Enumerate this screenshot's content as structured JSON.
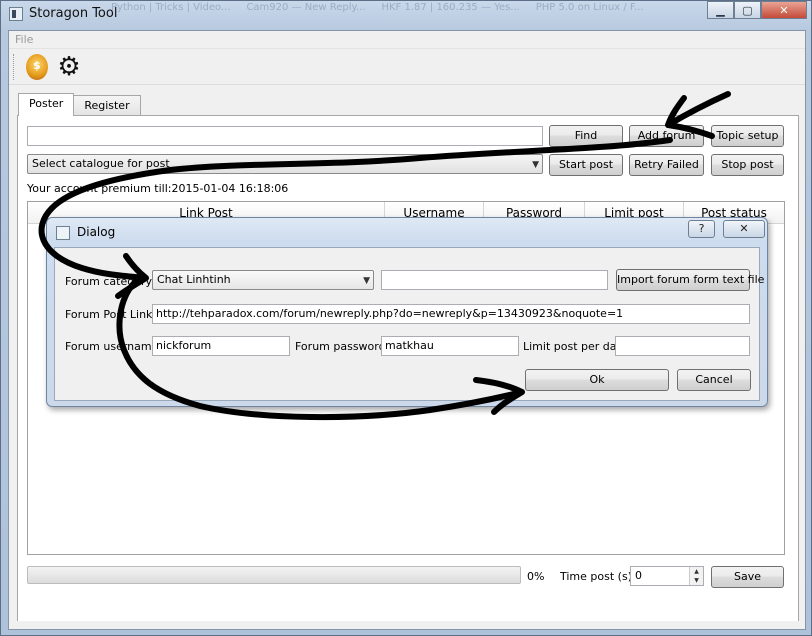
{
  "window": {
    "title": "Storagon Tool",
    "buttons": {
      "minimize": "▁",
      "maximize": "▢",
      "close": "✕"
    }
  },
  "background_tabs": [
    "Python | Tricks | Video...",
    "Cam920 — New Reply...",
    "HKF 1.87 | 160.235 — Yes...",
    "PHP 5.0 on Linux / F..."
  ],
  "menu": {
    "items": [
      "File"
    ]
  },
  "toolbar": {
    "icons": [
      "premium-user-icon",
      "gear-icon"
    ]
  },
  "tabs": [
    {
      "label": "Poster",
      "active": true
    },
    {
      "label": "Register",
      "active": false
    }
  ],
  "poster": {
    "search_value": "",
    "find_label": "Find",
    "add_forum_label": "Add forum",
    "topic_setup_label": "Topic setup",
    "catalogue_placeholder": "Select catalogue for post",
    "start_post_label": "Start post",
    "retry_failed_label": "Retry Failed",
    "stop_post_label": "Stop post",
    "account_info": "Your account premium till:2015-01-04 16:18:06",
    "table_columns": [
      "Link Post",
      "Username",
      "Password",
      "Limit post",
      "Post status"
    ],
    "progress_percent": 0,
    "progress_text": "0%",
    "time_post_label": "Time post (s)",
    "time_post_value": "0",
    "save_label": "Save"
  },
  "dialog": {
    "title": "Dialog",
    "help": "?",
    "close": "✕",
    "forum_category_label": "Forum category",
    "forum_category_value": "Chat Linhtinh",
    "category_extra_value": "",
    "import_label": "Import forum form text file",
    "forum_post_link_label": "Forum Post Link",
    "forum_post_link_value": "http://tehparadox.com/forum/newreply.php?do=newreply&p=13430923&noquote=1",
    "forum_username_label": "Forum username",
    "forum_username_value": "nickforum",
    "forum_password_label": "Forum password",
    "forum_password_value": "matkhau",
    "limit_post_label": "Limit post per day",
    "limit_post_value": "",
    "ok_label": "Ok",
    "cancel_label": "Cancel"
  },
  "colors": {
    "frame": "#b7c9df",
    "client_bg": "#f0f0f0",
    "dialog_bg": "#cddcee",
    "annotation_ink": "#000000"
  }
}
